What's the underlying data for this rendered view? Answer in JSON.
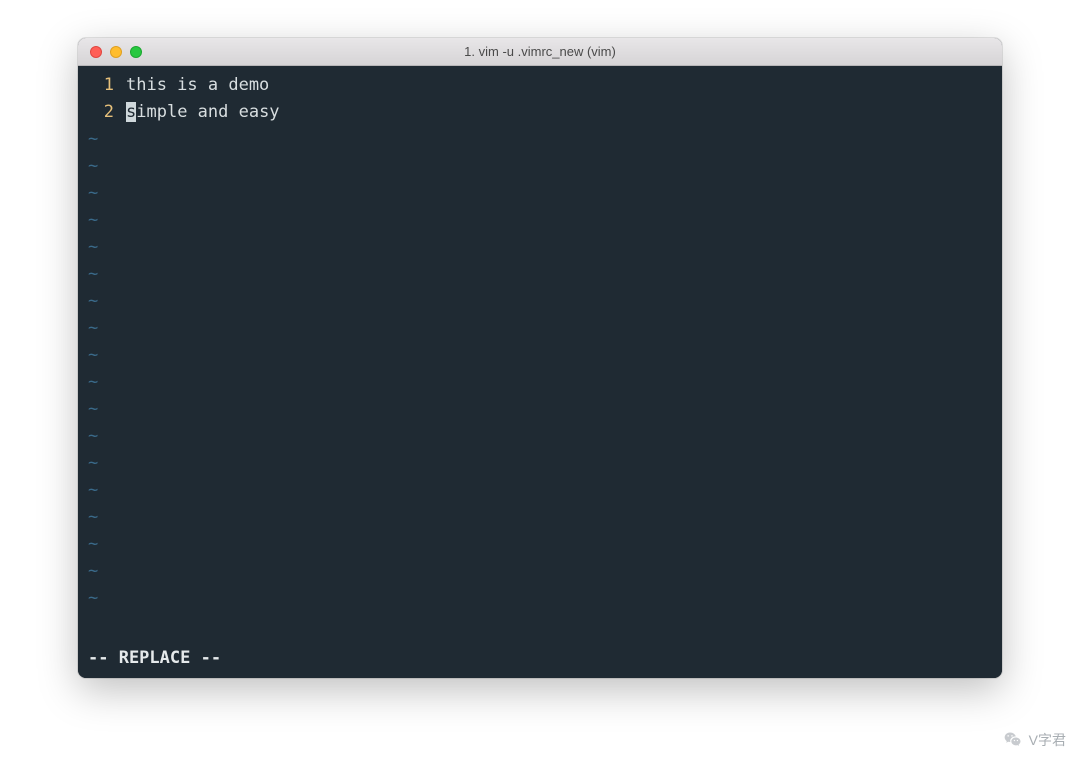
{
  "window": {
    "title": "1. vim -u .vimrc_new (vim)"
  },
  "editor": {
    "lines": [
      {
        "num": "1",
        "text": "this is a demo"
      },
      {
        "num": "2",
        "before_cursor": "",
        "cursor": "s",
        "after_cursor": "imple and easy"
      }
    ],
    "cursor_line_index": 1,
    "tilde": "~",
    "empty_rows": 18
  },
  "status": {
    "mode": "-- REPLACE --"
  },
  "watermark": {
    "text": "V字君"
  },
  "colors": {
    "bg": "#1f2a33",
    "gutter": "#e6c07b",
    "tilde": "#3a6a8a",
    "cursor_bg": "#cfd8dc"
  }
}
